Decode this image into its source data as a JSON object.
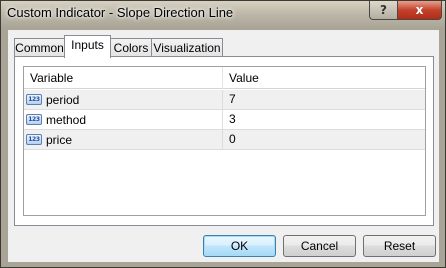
{
  "window": {
    "title": "Custom Indicator - Slope Direction Line"
  },
  "titlebar_buttons": {
    "help": "?",
    "close": "x"
  },
  "tabs": [
    {
      "label": "Common",
      "active": false
    },
    {
      "label": "Inputs",
      "active": true
    },
    {
      "label": "Colors",
      "active": false
    },
    {
      "label": "Visualization",
      "active": false
    }
  ],
  "grid": {
    "columns": [
      "Variable",
      "Value"
    ],
    "rows": [
      {
        "icon": "numeric-123-icon",
        "icon_text": "123",
        "variable": "period",
        "value": "7"
      },
      {
        "icon": "numeric-123-icon",
        "icon_text": "123",
        "variable": "method",
        "value": "3"
      },
      {
        "icon": "numeric-123-icon",
        "icon_text": "123",
        "variable": "price",
        "value": "0"
      }
    ]
  },
  "buttons": {
    "ok": "OK",
    "cancel": "Cancel",
    "reset": "Reset"
  }
}
